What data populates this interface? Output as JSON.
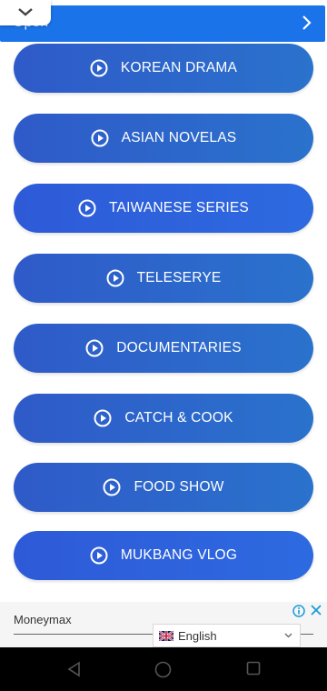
{
  "top_banner": {
    "open_label": "Open"
  },
  "menu": {
    "items": [
      {
        "label": "KOREAN DRAMA"
      },
      {
        "label": "ASIAN NOVELAS"
      },
      {
        "label": "TAIWANESE SERIES"
      },
      {
        "label": "TELESERYE"
      },
      {
        "label": "DOCUMENTARIES"
      },
      {
        "label": "CATCH & COOK"
      },
      {
        "label": "FOOD SHOW"
      },
      {
        "label": "MUKBANG VLOG"
      }
    ]
  },
  "ad": {
    "brand": "Moneymax"
  },
  "language": {
    "selected": "English"
  },
  "colors": {
    "accent": "#1a73e8",
    "pill_a": "#2f5ac9",
    "pill_b": "#2e5ad8",
    "navbar": "#000000"
  }
}
